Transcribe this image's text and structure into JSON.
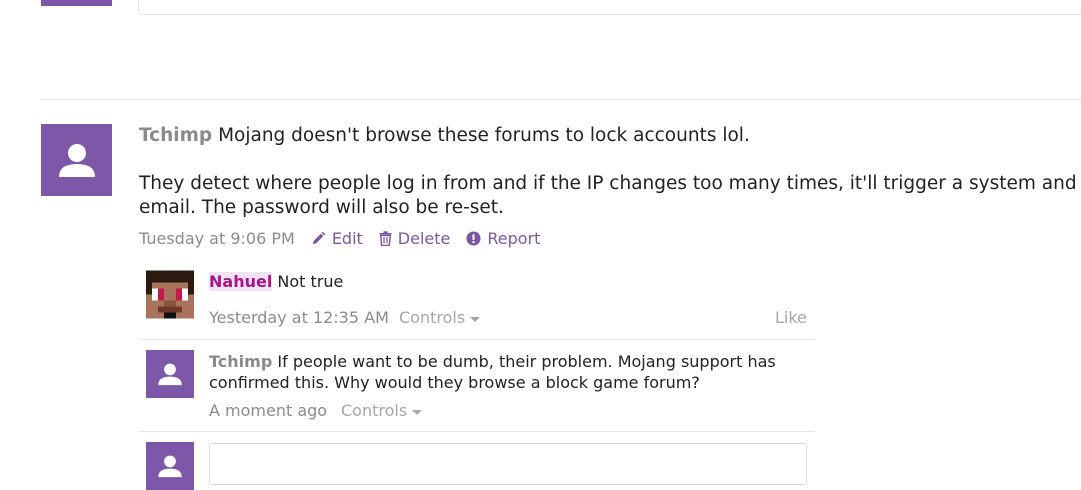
{
  "main_post": {
    "author": "Tchimp",
    "line1": "Mojang doesn't browse these forums to lock accounts lol.",
    "line2": "They detect where people log in from and if the IP changes too many times, it'll trigger a system and -con",
    "line3": "email. The password will also be re-set.",
    "time": "Tuesday at 9:06 PM",
    "actions": {
      "edit": "Edit",
      "delete": "Delete",
      "report": "Report"
    }
  },
  "comments": [
    {
      "author": "Nahuel",
      "text": "Not true",
      "time": "Yesterday at 12:35 AM",
      "controls": "Controls",
      "like": "Like"
    },
    {
      "author": "Tchimp",
      "text_line1": "If people want to be dumb, their problem. Mojang support has",
      "text_line2": "confirmed this. Why would they browse a block game forum?",
      "time": "A moment ago",
      "controls": "Controls"
    }
  ],
  "colors": {
    "accent": "#7d58a8",
    "highlight_name": "#a5168a",
    "muted_text": "#8c8c8c",
    "divider": "#e4e4e4"
  },
  "icons": {
    "avatar_placeholder": "person-silhouette-icon",
    "edit": "pencil-icon",
    "delete": "trash-icon",
    "report": "exclamation-circle-icon",
    "controls": "caret-down-icon"
  }
}
